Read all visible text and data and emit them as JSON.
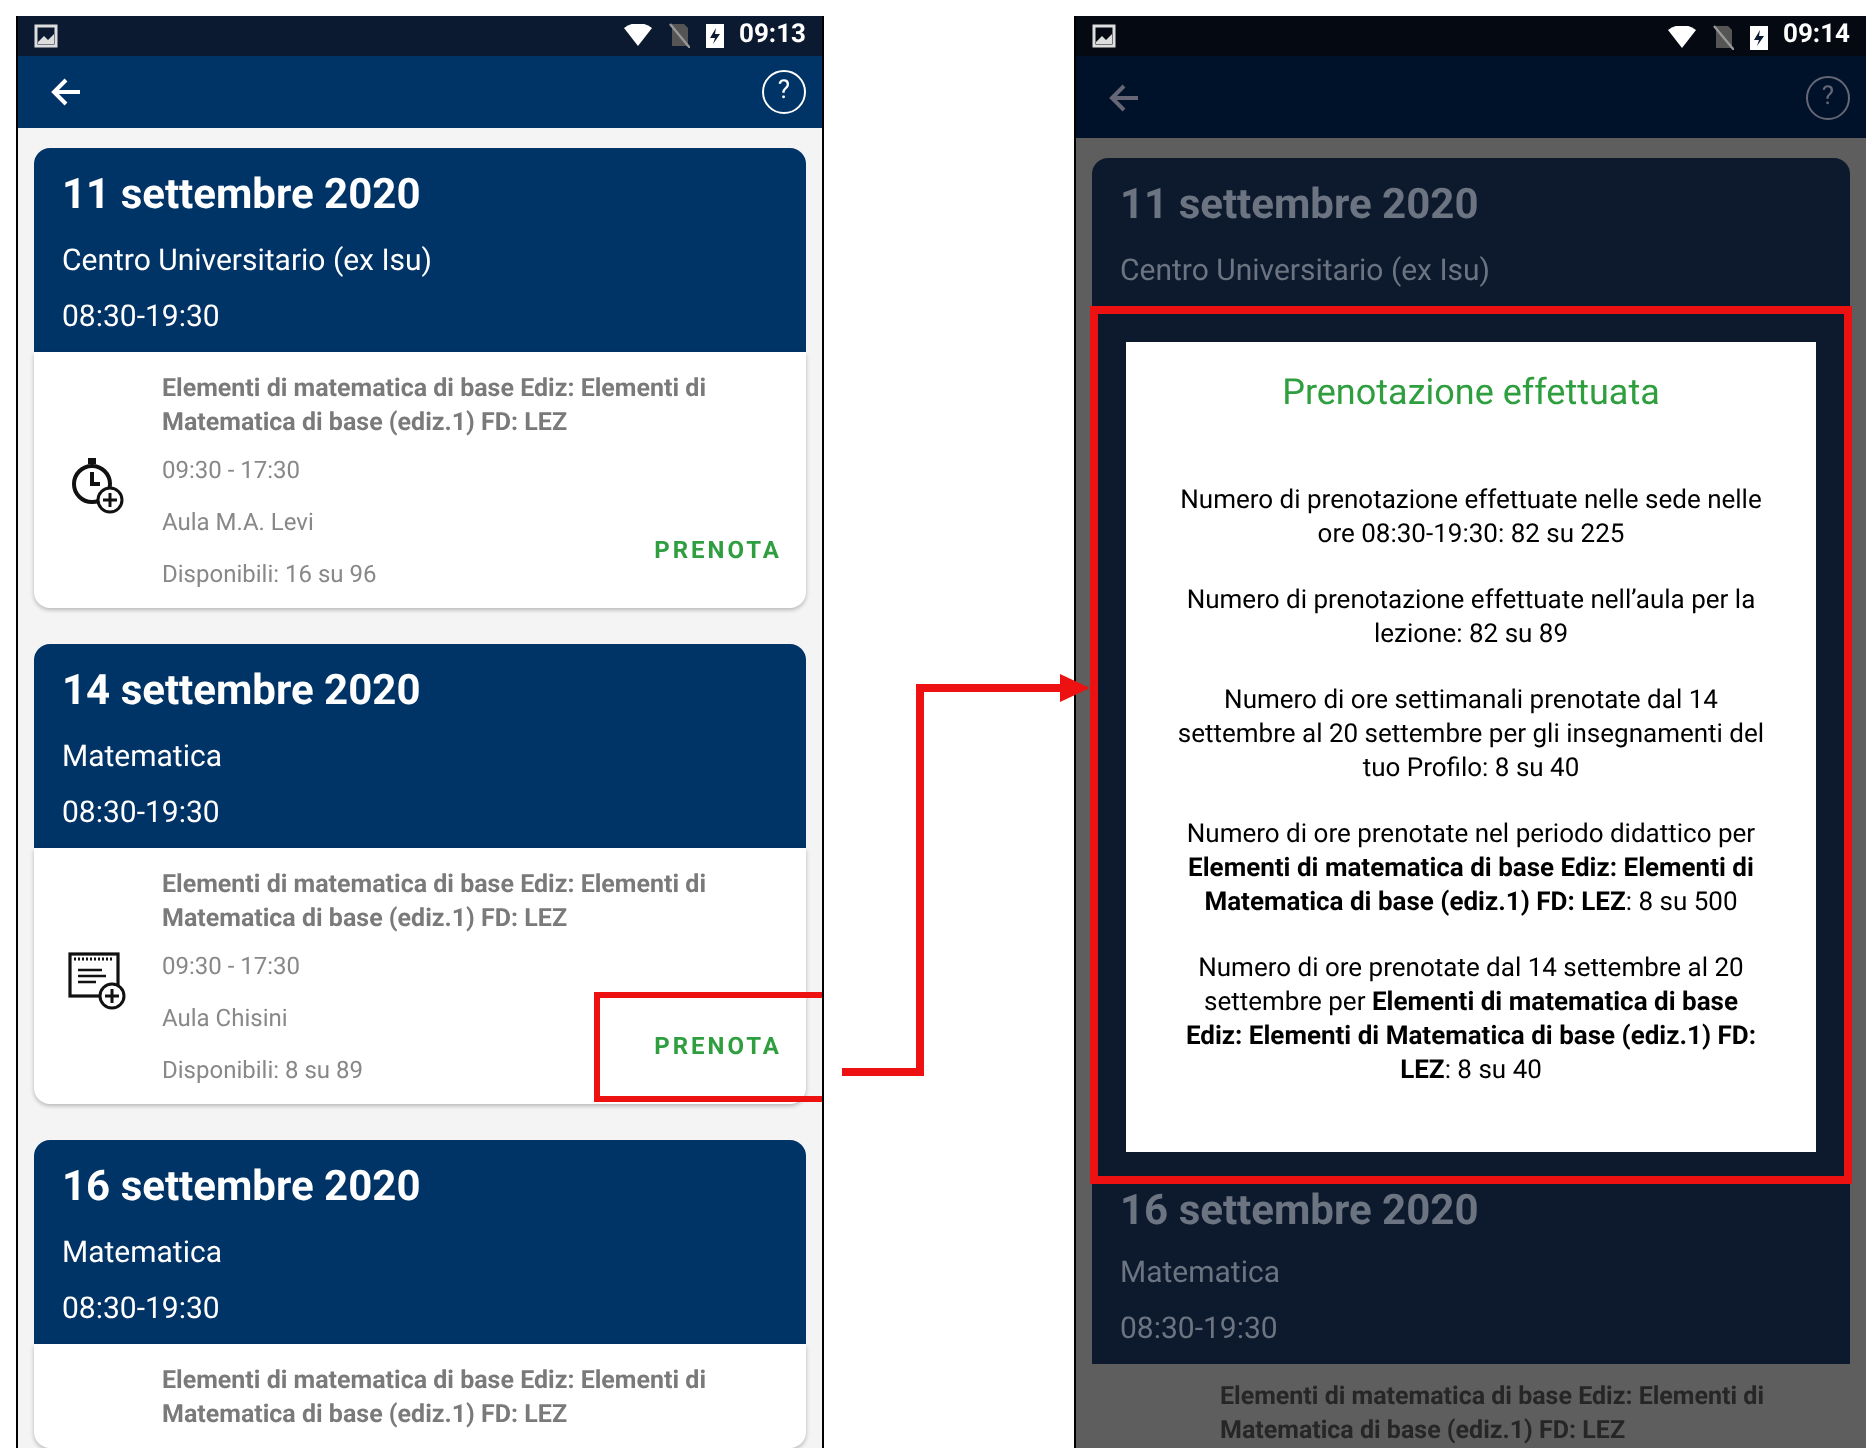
{
  "screens": [
    {
      "status_bar": {
        "time": "09:13"
      },
      "app_bar": {
        "help": "?"
      },
      "cards": [
        {
          "date": "11 settembre 2020",
          "location": "Centro Universitario (ex Isu)",
          "hours": "08:30-19:30",
          "lesson": {
            "kind": "stopwatch",
            "title": "Elementi di matematica di base Ediz: Elementi di Matematica di base (ediz.1) FD: LEZ",
            "time": "09:30 - 17:30",
            "room": "Aula M.A. Levi",
            "available": "Disponibili: 16 su 96",
            "action": "PRENOTA"
          }
        },
        {
          "date": "14 settembre 2020",
          "location": "Matematica",
          "hours": "08:30-19:30",
          "lesson": {
            "kind": "document",
            "title": "Elementi di matematica di base Ediz: Elementi di Matematica di base (ediz.1) FD: LEZ",
            "time": "09:30 - 17:30",
            "room": "Aula Chisini",
            "available": "Disponibili: 8 su 89",
            "action": "PRENOTA",
            "highlighted": true
          }
        },
        {
          "date": "16 settembre 2020",
          "location": "Matematica",
          "hours": "08:30-19:30",
          "lesson": {
            "title": "Elementi di matematica di base Ediz: Elementi di Matematica di base (ediz.1) FD: LEZ"
          }
        }
      ]
    },
    {
      "status_bar": {
        "time": "09:14"
      },
      "app_bar": {
        "help": "?"
      },
      "top_card": {
        "date": "11 settembre 2020",
        "location": "Centro Universitario (ex Isu)"
      },
      "dialog": {
        "highlighted": true,
        "title": "Prenotazione effettuata",
        "paragraphs": [
          "Numero di prenotazione effettuate nelle sede nelle ore 08:30-19:30: 82 su 225",
          "Numero di prenotazione effettuate nell’aula per la lezione: 82 su 89",
          "Numero di ore settimanali prenotate dal 14 settembre al 20 settembre per gli insegnamenti del tuo Profilo: 8 su 40",
          "Numero di ore prenotate nel periodo didattico per **Elementi di matematica di base Ediz: Elementi di Matematica di base (ediz.1) FD: LEZ**: 8 su 500",
          "Numero di ore prenotate dal 14 settembre al 20 settembre per **Elementi di matematica di base Ediz: Elementi di Matematica di base (ediz.1) FD: LEZ**: 8 su 40"
        ]
      },
      "bottom_card": {
        "date": "16 settembre 2020",
        "location": "Matematica",
        "hours": "08:30-19:30",
        "lesson_title": "Elementi di matematica di base Ediz: Elementi di Matematica di base (ediz.1) FD: LEZ"
      }
    }
  ]
}
